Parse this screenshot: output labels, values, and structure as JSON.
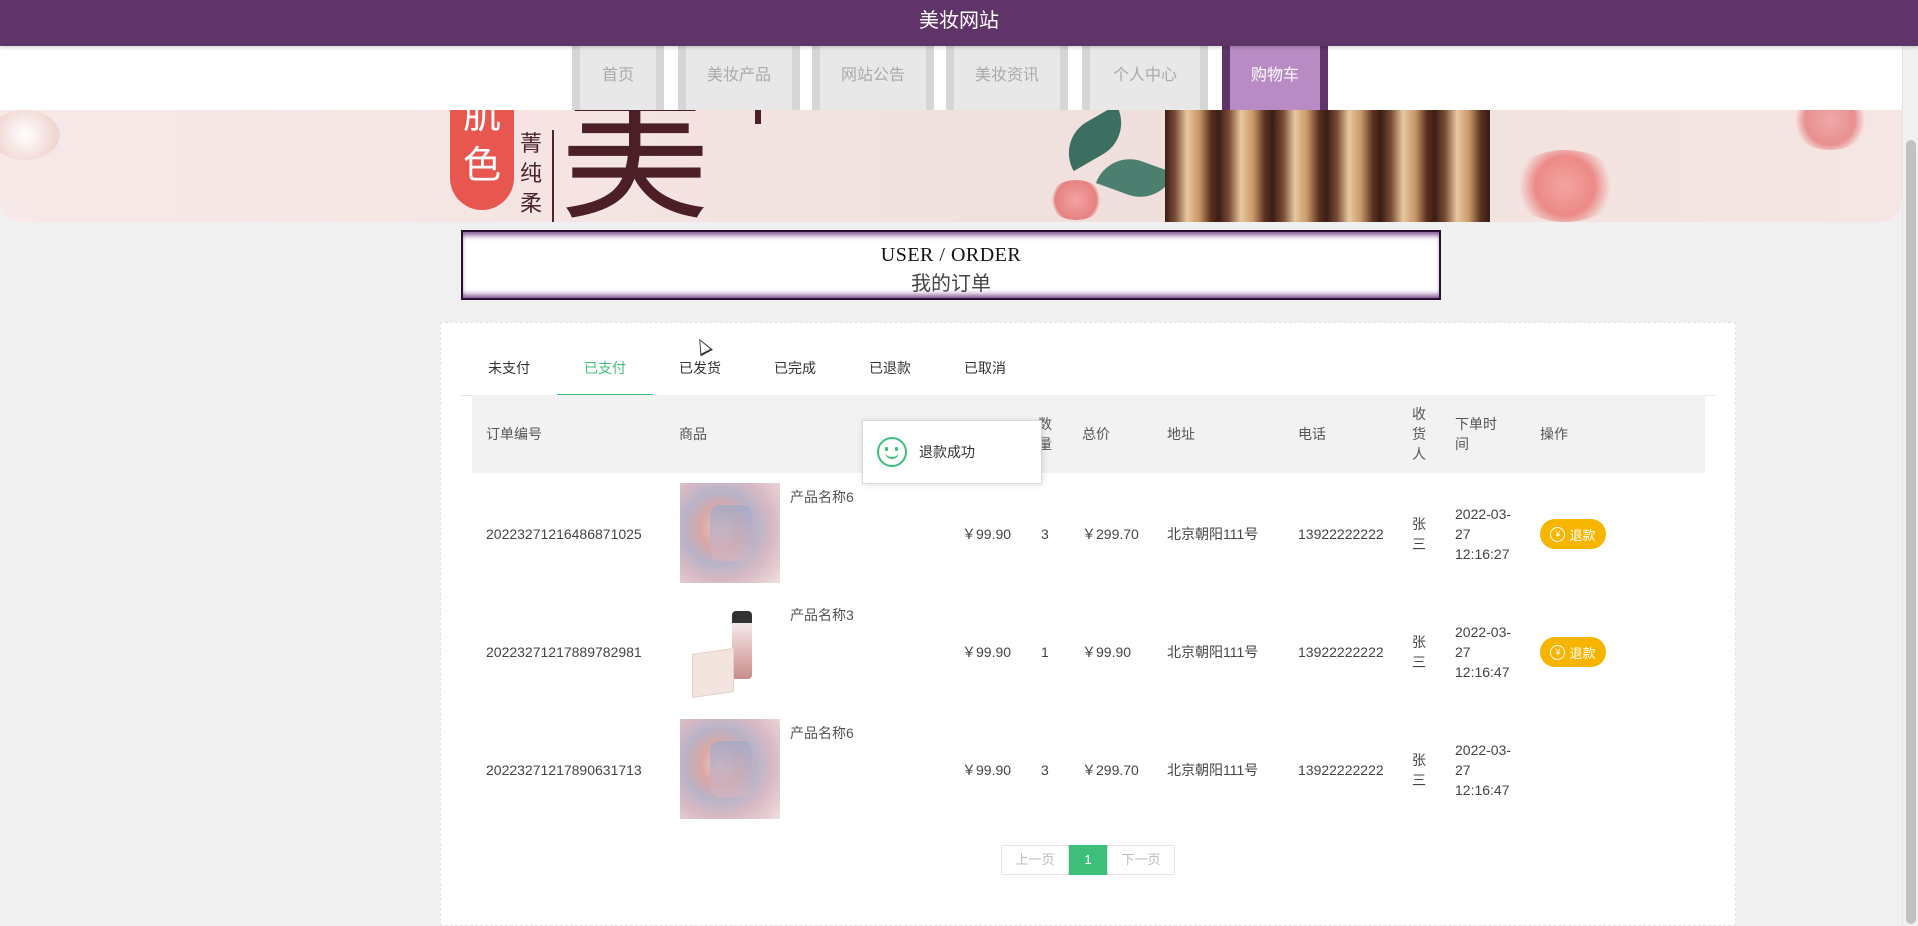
{
  "site": {
    "title": "美妆网站"
  },
  "nav": {
    "items": [
      {
        "label": "首页"
      },
      {
        "label": "美妆产品"
      },
      {
        "label": "网站公告"
      },
      {
        "label": "美妆资讯"
      },
      {
        "label": "个人中心"
      },
      {
        "label": "购物车"
      }
    ],
    "active_index": 5
  },
  "banner": {
    "badge_text": "肌色",
    "vertical_text": "菁纯柔",
    "big_char": "美"
  },
  "header": {
    "en": "USER / ORDER",
    "cn": "我的订单"
  },
  "tabs": {
    "items": [
      {
        "label": "未支付"
      },
      {
        "label": "已支付"
      },
      {
        "label": "已发货"
      },
      {
        "label": "已完成"
      },
      {
        "label": "已退款"
      },
      {
        "label": "已取消"
      }
    ],
    "active_index": 1
  },
  "table": {
    "headers": {
      "order_no": "订单编号",
      "product": "商品",
      "qty": "数量",
      "total": "总价",
      "address": "地址",
      "phone": "电话",
      "receiver": "收货人",
      "order_time": "下单时间",
      "action": "操作"
    },
    "rows": [
      {
        "order_no": "20223271216486871025",
        "product_name": "产品名称6",
        "product_image": "perfume",
        "price": "￥99.90",
        "qty": "3",
        "total": "￥299.70",
        "address": "北京朝阳111号",
        "phone": "13922222222",
        "receiver": "张三",
        "order_time": "2022-03-27 12:16:27",
        "action_label": "退款",
        "has_action": true
      },
      {
        "order_no": "20223271217889782981",
        "product_name": "产品名称3",
        "product_image": "serum",
        "price": "￥99.90",
        "qty": "1",
        "total": "￥99.90",
        "address": "北京朝阳111号",
        "phone": "13922222222",
        "receiver": "张三",
        "order_time": "2022-03-27 12:16:47",
        "action_label": "退款",
        "has_action": true
      },
      {
        "order_no": "20223271217890631713",
        "product_name": "产品名称6",
        "product_image": "perfume",
        "price": "￥99.90",
        "qty": "3",
        "total": "￥299.70",
        "address": "北京朝阳111号",
        "phone": "13922222222",
        "receiver": "张三",
        "order_time": "2022-03-27 12:16:47",
        "action_label": "",
        "has_action": false
      }
    ]
  },
  "pagination": {
    "prev": "上一页",
    "current": "1",
    "next": "下一页"
  },
  "toast": {
    "message": "退款成功"
  },
  "colors": {
    "brand": "#5f3468",
    "accent": "#3dbf7a",
    "refund": "#f7b500",
    "nav_active": "#b98bc4"
  }
}
